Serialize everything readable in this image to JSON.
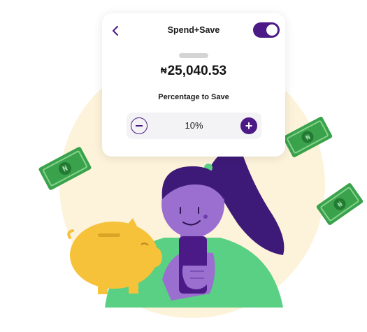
{
  "header": {
    "title": "Spend+Save",
    "back_icon": "chevron-left-icon",
    "toggle_on": true
  },
  "balance": {
    "currency": "₦",
    "amount": "25,040.53"
  },
  "savings": {
    "label": "Percentage to Save",
    "value": "10%",
    "minus_icon": "minus-icon",
    "plus_icon": "plus-icon",
    "plus_symbol": "+"
  },
  "colors": {
    "brand_purple": "#4b1a86",
    "illustration_bg": "#fdf3da",
    "cash_green": "#3aa24a",
    "shirt_green": "#5ad084",
    "piggy_yellow": "#f5c23a",
    "skin_purple": "#9b6fd0"
  },
  "illustration": {
    "subject": "woman holding phone",
    "elements": [
      "piggy-bank",
      "naira-banknotes"
    ]
  }
}
